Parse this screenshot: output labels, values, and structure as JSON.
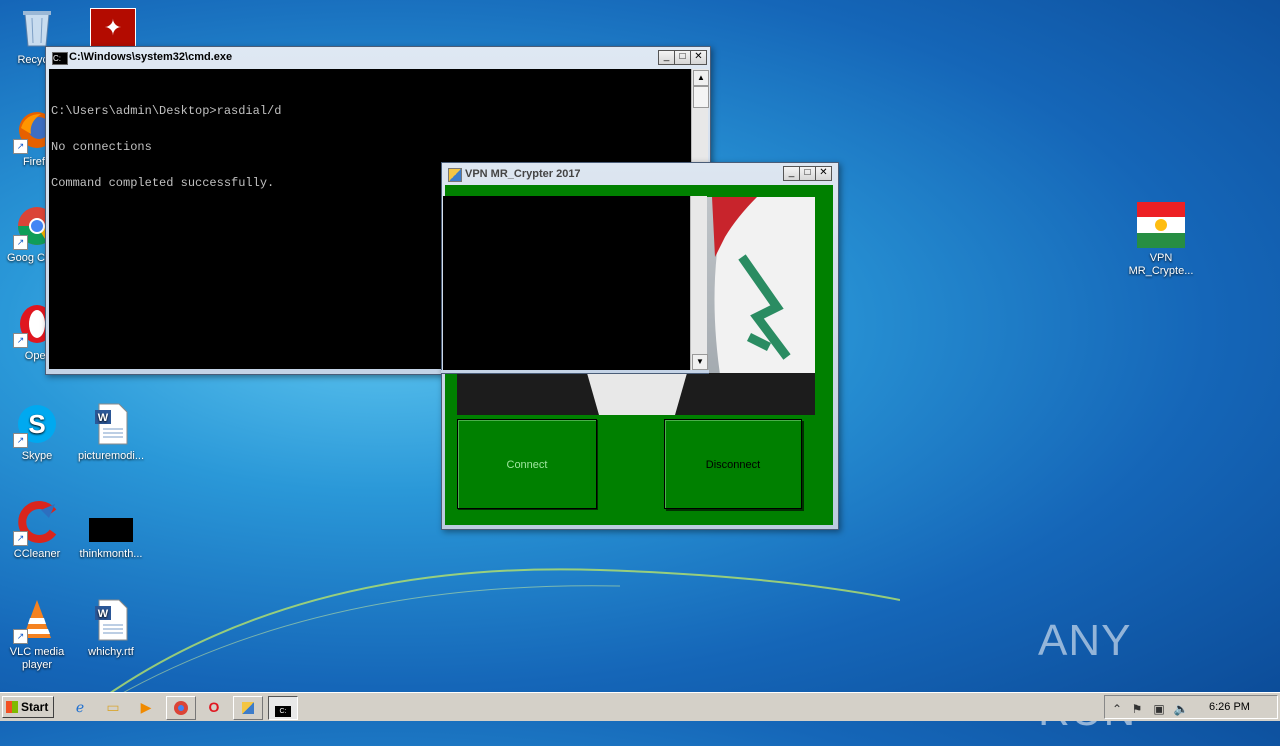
{
  "desktop": {
    "icons": [
      {
        "label": "Recycle",
        "icon": "recycle-bin-icon"
      },
      {
        "label": "Firefo",
        "icon": "firefox-icon"
      },
      {
        "label": "Goog Chron",
        "icon": "chrome-icon"
      },
      {
        "label": "Oper",
        "icon": "opera-icon"
      },
      {
        "label": "Skype",
        "icon": "skype-icon"
      },
      {
        "label": "picturemodi...",
        "icon": "word-doc-icon"
      },
      {
        "label": "CCleaner",
        "icon": "ccleaner-icon"
      },
      {
        "label": "thinkmonth...",
        "icon": "black-file-icon"
      },
      {
        "label": "VLC media player",
        "icon": "vlc-icon"
      },
      {
        "label": "whichy.rtf",
        "icon": "word-doc-icon"
      },
      {
        "label": "VPN MR_Crypte...",
        "icon": "kurdistan-flag-icon"
      }
    ],
    "watermark": "ANY RUN"
  },
  "cmd_window": {
    "title": "C:\\Windows\\system32\\cmd.exe",
    "lines": [
      "C:\\Users\\admin\\Desktop>rasdial/d",
      "No connections",
      "Command completed successfully."
    ]
  },
  "vpn_window": {
    "title": "VPN MR_Crypter 2017",
    "connect_label": "Connect",
    "disconnect_label": "Disconnect"
  },
  "taskbar": {
    "start_label": "Start",
    "clock": "6:26 PM"
  },
  "colors": {
    "vpn_green": "#008000",
    "cmd_bg": "#000000",
    "taskbar_bg": "#d4d0c8"
  }
}
